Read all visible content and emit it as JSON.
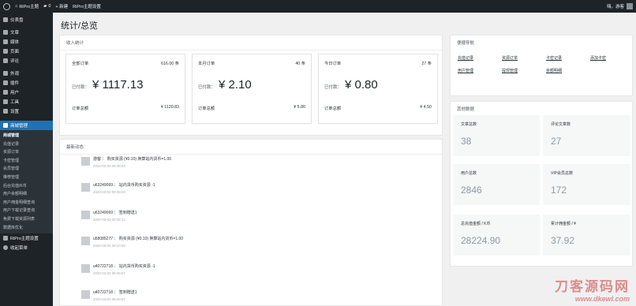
{
  "adminbar": {
    "site_name": "RiPro主题",
    "comments_count": "0",
    "new_label": "+ 新建",
    "theme_settings": "RiPro主题设置",
    "greeting": "嗨，游客"
  },
  "sidebar": {
    "items": [
      {
        "label": "仪表盘"
      },
      {
        "label": "文章"
      },
      {
        "label": "媒体"
      },
      {
        "label": "页面"
      },
      {
        "label": "评论"
      },
      {
        "label": "外观"
      },
      {
        "label": "插件"
      },
      {
        "label": "用户"
      },
      {
        "label": "工具"
      },
      {
        "label": "设置"
      }
    ],
    "active_item": "商城管理",
    "submenu": [
      "商城管理",
      "充值记录",
      "资源订单",
      "卡密管理",
      "会员管理",
      "推荐管理",
      "后台充值/K币",
      "用户余额明细",
      "用户佣金明细查询",
      "用户下载记录查询",
      "免费下载资源列表",
      "数据库优化"
    ],
    "footer_items": [
      {
        "label": "RiPro主题设置"
      },
      {
        "label": "收起菜单"
      }
    ]
  },
  "page": {
    "title": "统计/总览",
    "income_panel_title": "收入统计",
    "activity_panel_title": "最新动态",
    "quicknav_title": "便捷导航",
    "other_stats_title": "其他数据"
  },
  "order_cards": [
    {
      "title": "全部订单",
      "count": "616.00 条",
      "paid_label": "已付款：",
      "amount": "¥ 1117.13",
      "total_label": "订单总额",
      "total": "¥ 1120.83"
    },
    {
      "title": "本月订单",
      "count": "40 条",
      "paid_label": "已付款：",
      "amount": "¥ 2.10",
      "total_label": "订单总额",
      "total": "¥ 5.80"
    },
    {
      "title": "今日订单",
      "count": "27 条",
      "paid_label": "已付款：",
      "amount": "¥ 0.80",
      "total_label": "订单总额",
      "total": "¥ 4.50"
    }
  ],
  "activities": [
    {
      "text": "游客 ： 购买资源 (¥0.10) 换算站内货币=1.00",
      "time": "2020-03-02 09:35:03"
    },
    {
      "text": "u63249069 ： 站内货币购买资源 -1",
      "time": "2020-03-02 09:35:00"
    },
    {
      "text": "u63249069 ： 签到赠送1",
      "time": "2020-03-02 09:35:14"
    },
    {
      "text": "u58085277 ： 购买资源 (¥0.10) 换算站内货币=1.00",
      "time": "2020-03-02 09:10:28"
    },
    {
      "text": "u40722718 ： 站内货币购买资源 -1",
      "time": "2020-03-02 08:46:07"
    },
    {
      "text": "u40722718 ： 签到赠送1",
      "time": "2020-03-02 08:46:07"
    }
  ],
  "quick_links": [
    "充值记录",
    "资源订单",
    "卡密记录",
    "添加卡密",
    "用户管理",
    "提现管理",
    "余额明细"
  ],
  "stats": [
    {
      "label": "文章总数",
      "value": "38"
    },
    {
      "label": "评论文章数",
      "value": "27"
    },
    {
      "label": "用户总数",
      "value": "2846"
    },
    {
      "label": "VIP会员总数",
      "value": "172"
    },
    {
      "label": "总充值金额 / K币",
      "value": "28224.90"
    },
    {
      "label": "累计佣金额 / ¥",
      "value": "37.92"
    }
  ],
  "watermark": {
    "line1": "刀客源码网",
    "line2": "www.dkewl.com"
  }
}
